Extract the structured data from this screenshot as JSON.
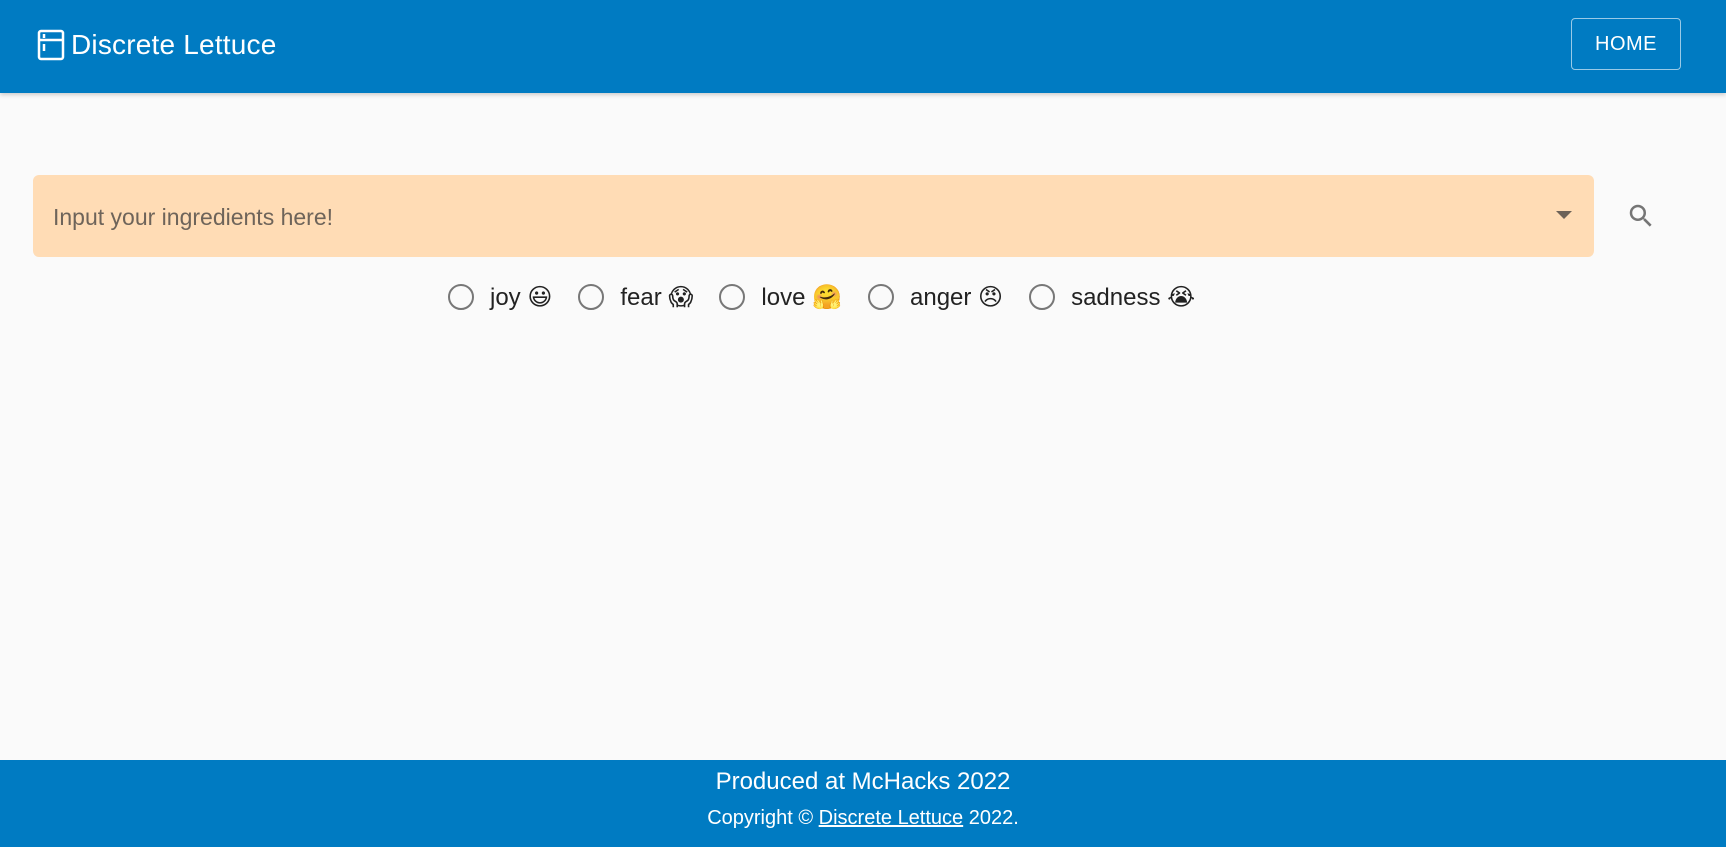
{
  "header": {
    "brand_name": "Discrete Lettuce",
    "brand_icon": "fridge-icon",
    "home_label": "HOME"
  },
  "search": {
    "placeholder": "Input your ingredients here!",
    "value": "",
    "dropdown_icon": "caret-down-icon",
    "search_icon": "search-icon"
  },
  "moods": [
    {
      "label": "joy 😃",
      "selected": false
    },
    {
      "label": "fear 😱",
      "selected": false
    },
    {
      "label": "love 🤗",
      "selected": false
    },
    {
      "label": "anger 😠",
      "selected": false
    },
    {
      "label": "sadness 😭",
      "selected": false
    }
  ],
  "footer": {
    "line1": "Produced at McHacks 2022",
    "copyright_prefix": "Copyright ©",
    "copyright_link": "Discrete Lettuce",
    "copyright_suffix": "2022."
  },
  "colors": {
    "primary": "#007bc2",
    "search_field_bg": "#ffdcb5",
    "page_bg": "#fafafa"
  }
}
